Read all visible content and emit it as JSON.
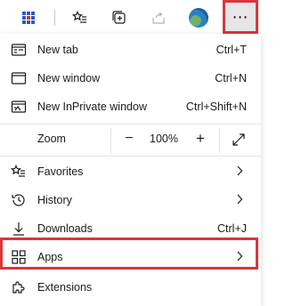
{
  "toolbar": {
    "icons": [
      "collections-grid-icon",
      "favorites-star-icon",
      "add-collection-icon",
      "share-icon",
      "profile-avatar",
      "more-options-icon"
    ],
    "more_label": "⋯"
  },
  "menu": {
    "new_tab": {
      "label": "New tab",
      "shortcut": "Ctrl+T",
      "icon": "new-tab-icon"
    },
    "new_window": {
      "label": "New window",
      "shortcut": "Ctrl+N",
      "icon": "new-window-icon"
    },
    "new_inprivate": {
      "label": "New InPrivate window",
      "shortcut": "Ctrl+Shift+N",
      "icon": "inprivate-window-icon"
    },
    "zoom": {
      "label": "Zoom",
      "minus": "−",
      "value": "100%",
      "plus": "+",
      "fullscreen_icon": "fullscreen-icon"
    },
    "favorites": {
      "label": "Favorites",
      "icon": "favorites-icon"
    },
    "history": {
      "label": "History",
      "icon": "history-icon"
    },
    "downloads": {
      "label": "Downloads",
      "shortcut": "Ctrl+J",
      "icon": "download-icon"
    },
    "apps": {
      "label": "Apps",
      "icon": "apps-icon"
    },
    "extensions": {
      "label": "Extensions",
      "icon": "extensions-puzzle-icon"
    }
  },
  "colors": {
    "highlight": "#d9373b",
    "accent": "#2d7fc7"
  }
}
